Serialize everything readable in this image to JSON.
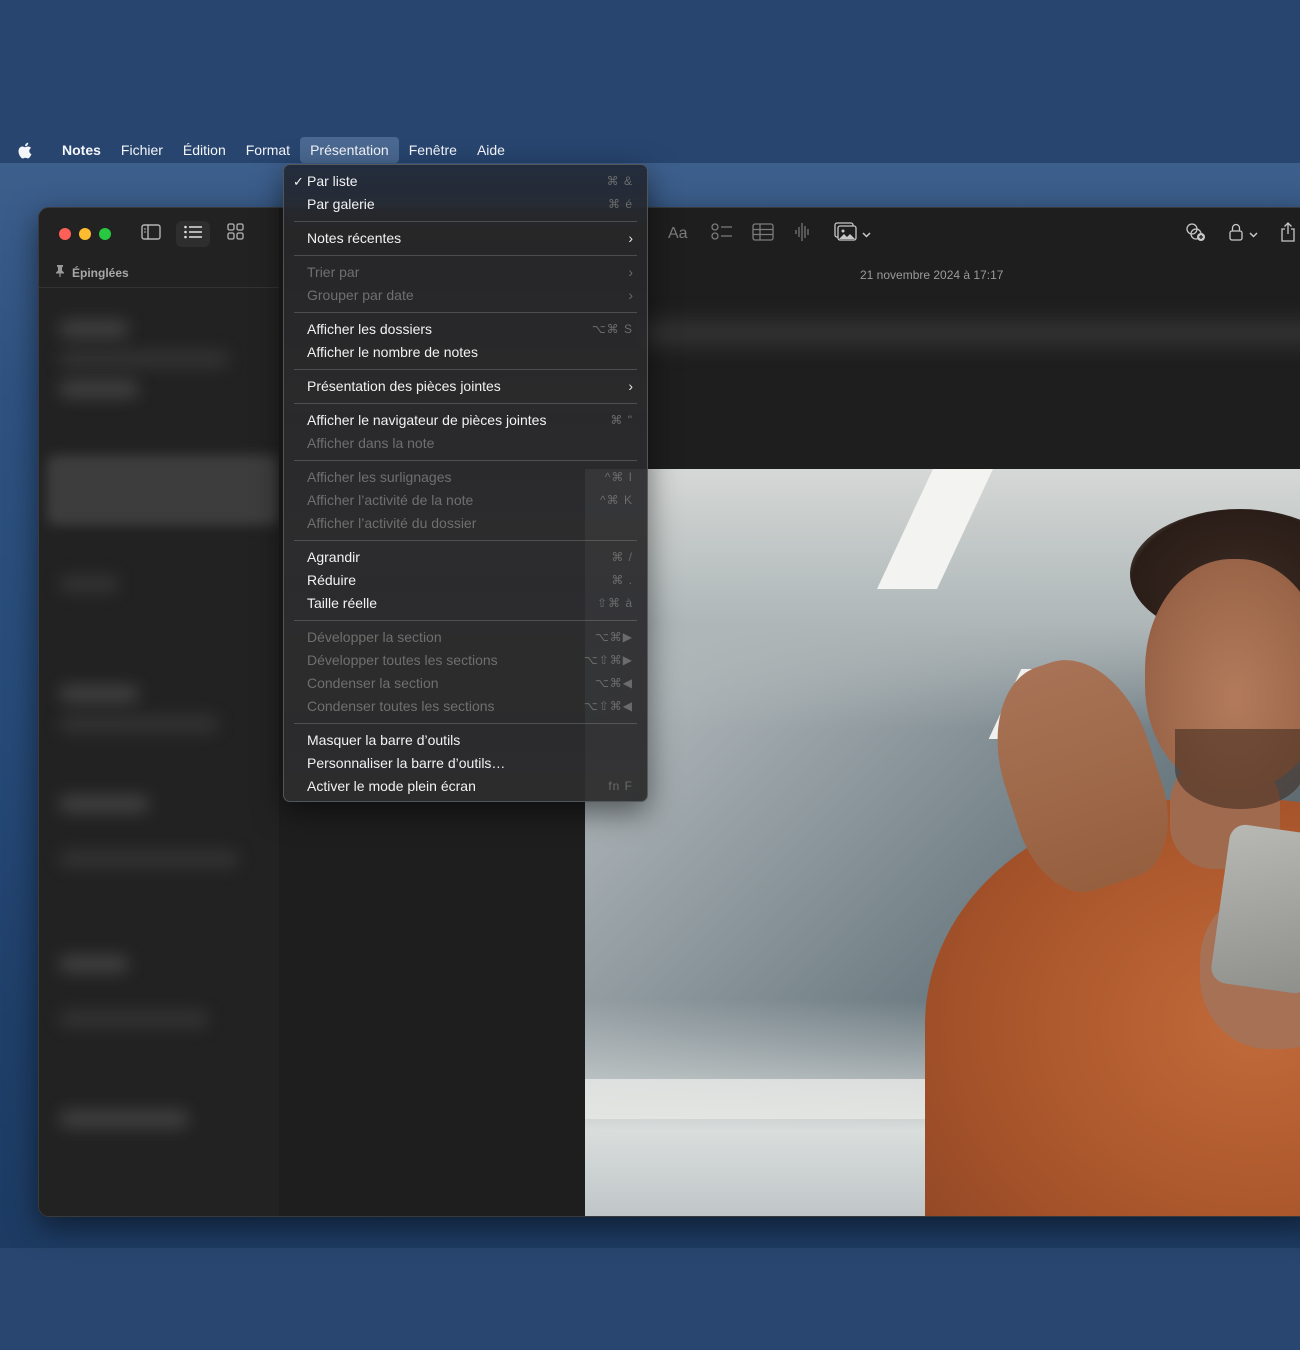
{
  "menubar": {
    "app_name": "Notes",
    "items": [
      "Fichier",
      "Édition",
      "Format",
      "Présentation",
      "Fenêtre",
      "Aide"
    ],
    "active_item": "Présentation"
  },
  "menu": {
    "groups": [
      [
        {
          "label": "Par liste",
          "shortcut": "⌘ &",
          "checked": true,
          "enabled": true
        },
        {
          "label": "Par galerie",
          "shortcut": "⌘ é",
          "checked": false,
          "enabled": true
        }
      ],
      [
        {
          "label": "Notes récentes",
          "submenu": true,
          "enabled": true
        }
      ],
      [
        {
          "label": "Trier par",
          "submenu": true,
          "enabled": false
        },
        {
          "label": "Grouper par date",
          "submenu": true,
          "enabled": false
        }
      ],
      [
        {
          "label": "Afficher les dossiers",
          "shortcut": "⌥⌘ S",
          "enabled": true
        },
        {
          "label": "Afficher le nombre de notes",
          "enabled": true
        }
      ],
      [
        {
          "label": "Présentation des pièces jointes",
          "submenu": true,
          "enabled": true
        }
      ],
      [
        {
          "label": "Afficher le navigateur de pièces jointes",
          "shortcut": "⌘ \"",
          "enabled": true
        },
        {
          "label": "Afficher dans la note",
          "enabled": false
        }
      ],
      [
        {
          "label": "Afficher les surlignages",
          "shortcut": "^⌘ I",
          "enabled": false
        },
        {
          "label": "Afficher l’activité de la note",
          "shortcut": "^⌘ K",
          "enabled": false
        },
        {
          "label": "Afficher l’activité du dossier",
          "enabled": false
        }
      ],
      [
        {
          "label": "Agrandir",
          "shortcut": "⌘ /",
          "enabled": true
        },
        {
          "label": "Réduire",
          "shortcut": "⌘ .",
          "enabled": true
        },
        {
          "label": "Taille réelle",
          "shortcut": "⇧⌘ à",
          "enabled": true
        }
      ],
      [
        {
          "label": "Développer la section",
          "shortcut": "⌥⌘▶",
          "enabled": false
        },
        {
          "label": "Développer toutes les sections",
          "shortcut": "⌥⇧⌘▶",
          "enabled": false
        },
        {
          "label": "Condenser la section",
          "shortcut": "⌥⌘◀",
          "enabled": false
        },
        {
          "label": "Condenser toutes les sections",
          "shortcut": "⌥⇧⌘◀",
          "enabled": false
        }
      ],
      [
        {
          "label": "Masquer la barre d’outils",
          "enabled": true
        },
        {
          "label": "Personnaliser la barre d’outils…",
          "enabled": true
        },
        {
          "label": "Activer le mode plein écran",
          "shortcut": "fn F",
          "enabled": true
        }
      ]
    ]
  },
  "sidebar": {
    "pinned_label": "Épinglées"
  },
  "editor": {
    "toolbar": {
      "format_label": "Aa"
    },
    "note_date": "21 novembre 2024 à 17:17"
  },
  "colors": {
    "desktop": "#284670",
    "window_bg": "#1f1f1f",
    "close": "#fe5f57",
    "minimize": "#febc2e",
    "maximize": "#28c840"
  }
}
